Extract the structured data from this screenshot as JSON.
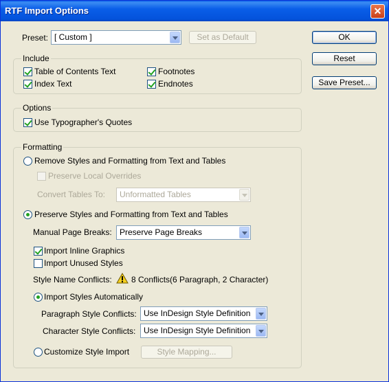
{
  "window": {
    "title": "RTF Import Options"
  },
  "preset": {
    "label": "Preset:",
    "value": "[ Custom ]",
    "set_default_label": "Set as Default"
  },
  "buttons": {
    "ok": "OK",
    "reset": "Reset",
    "save_preset": "Save Preset..."
  },
  "include": {
    "title": "Include",
    "toc": {
      "label": "Table of Contents Text",
      "checked": true
    },
    "index": {
      "label": "Index Text",
      "checked": true
    },
    "footnotes": {
      "label": "Footnotes",
      "checked": true
    },
    "endnotes": {
      "label": "Endnotes",
      "checked": true
    }
  },
  "options": {
    "title": "Options",
    "quotes": {
      "label": "Use Typographer's Quotes",
      "checked": true
    }
  },
  "formatting": {
    "title": "Formatting",
    "remove_label": "Remove Styles and Formatting from Text and Tables",
    "preserve_local_label": "Preserve Local Overrides",
    "convert_tables_label": "Convert Tables To:",
    "convert_tables_value": "Unformatted Tables",
    "preserve_label": "Preserve Styles and Formatting from Text and Tables",
    "page_breaks_label": "Manual Page Breaks:",
    "page_breaks_value": "Preserve Page Breaks",
    "inline_graphics_label": "Import Inline Graphics",
    "unused_styles_label": "Import Unused Styles",
    "conflicts_label": "Style Name Conflicts:",
    "conflicts_value": "8 Conflicts(6 Paragraph, 2 Character)",
    "import_auto_label": "Import Styles Automatically",
    "para_conflicts_label": "Paragraph Style Conflicts:",
    "para_conflicts_value": "Use InDesign Style Definition",
    "char_conflicts_label": "Character Style Conflicts:",
    "char_conflicts_value": "Use InDesign Style Definition",
    "customize_label": "Customize Style Import",
    "style_mapping_label": "Style Mapping..."
  },
  "icons": {
    "close": "close-icon",
    "warning": "warning-icon"
  }
}
